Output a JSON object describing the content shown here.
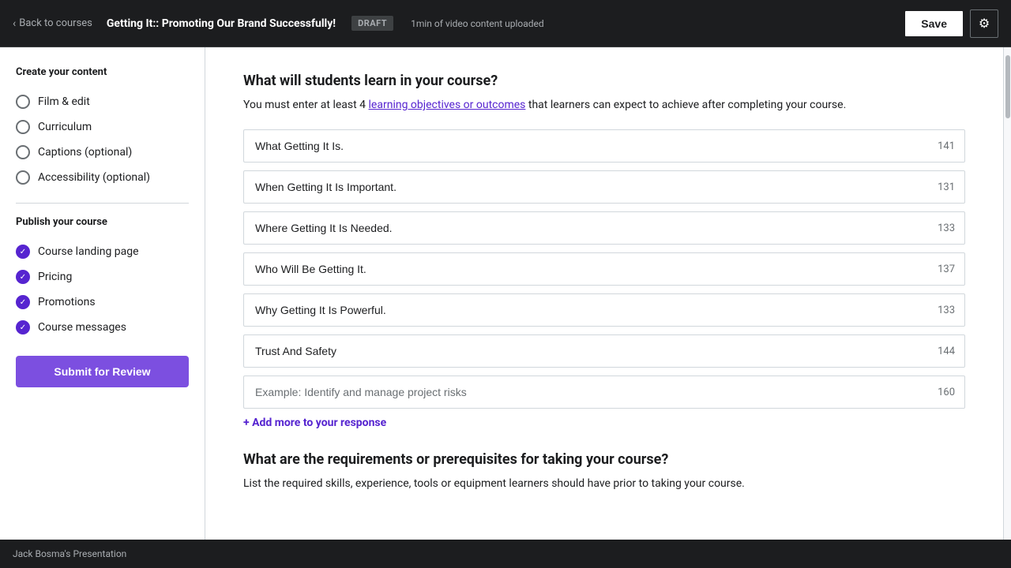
{
  "topbar": {
    "back_label": "Back to courses",
    "course_title": "Getting It:: Promoting Our Brand Successfully!",
    "draft_badge": "DRAFT",
    "upload_status": "1min of video content uploaded",
    "save_label": "Save",
    "gear_icon": "⚙"
  },
  "sidebar": {
    "create_section_title": "Create your content",
    "create_items": [
      {
        "label": "Film & edit",
        "checked": false
      },
      {
        "label": "Curriculum",
        "checked": false
      },
      {
        "label": "Captions (optional)",
        "checked": false
      },
      {
        "label": "Accessibility (optional)",
        "checked": false
      }
    ],
    "publish_section_title": "Publish your course",
    "publish_items": [
      {
        "label": "Course landing page",
        "checked": true
      },
      {
        "label": "Pricing",
        "checked": true
      },
      {
        "label": "Promotions",
        "checked": true
      },
      {
        "label": "Course messages",
        "checked": true
      }
    ],
    "submit_label": "Submit for Review"
  },
  "main": {
    "objectives_heading": "What will students learn in your course?",
    "objectives_desc_before": "You must enter at least 4 ",
    "objectives_link_text": "learning objectives or outcomes",
    "objectives_desc_after": " that learners can expect to achieve after completing your course.",
    "objectives_inputs": [
      {
        "value": "What Getting It Is.",
        "char_count": "141"
      },
      {
        "value": "When Getting It Is Important.",
        "char_count": "131"
      },
      {
        "value": "Where Getting It Is Needed.",
        "char_count": "133"
      },
      {
        "value": "Who Will Be Getting It.",
        "char_count": "137"
      },
      {
        "value": "Why Getting It Is Powerful.",
        "char_count": "133"
      },
      {
        "value": "Trust And Safety",
        "char_count": "144"
      },
      {
        "value": "",
        "placeholder": "Example: Identify and manage project risks",
        "char_count": "160"
      }
    ],
    "add_more_label": "+ Add more to your response",
    "requirements_heading": "What are the requirements or prerequisites for taking your course?",
    "requirements_desc": "List the required skills, experience, tools or equipment learners should have prior to taking your course."
  },
  "bottom_bar": {
    "text": "Jack Bosma's Presentation"
  }
}
